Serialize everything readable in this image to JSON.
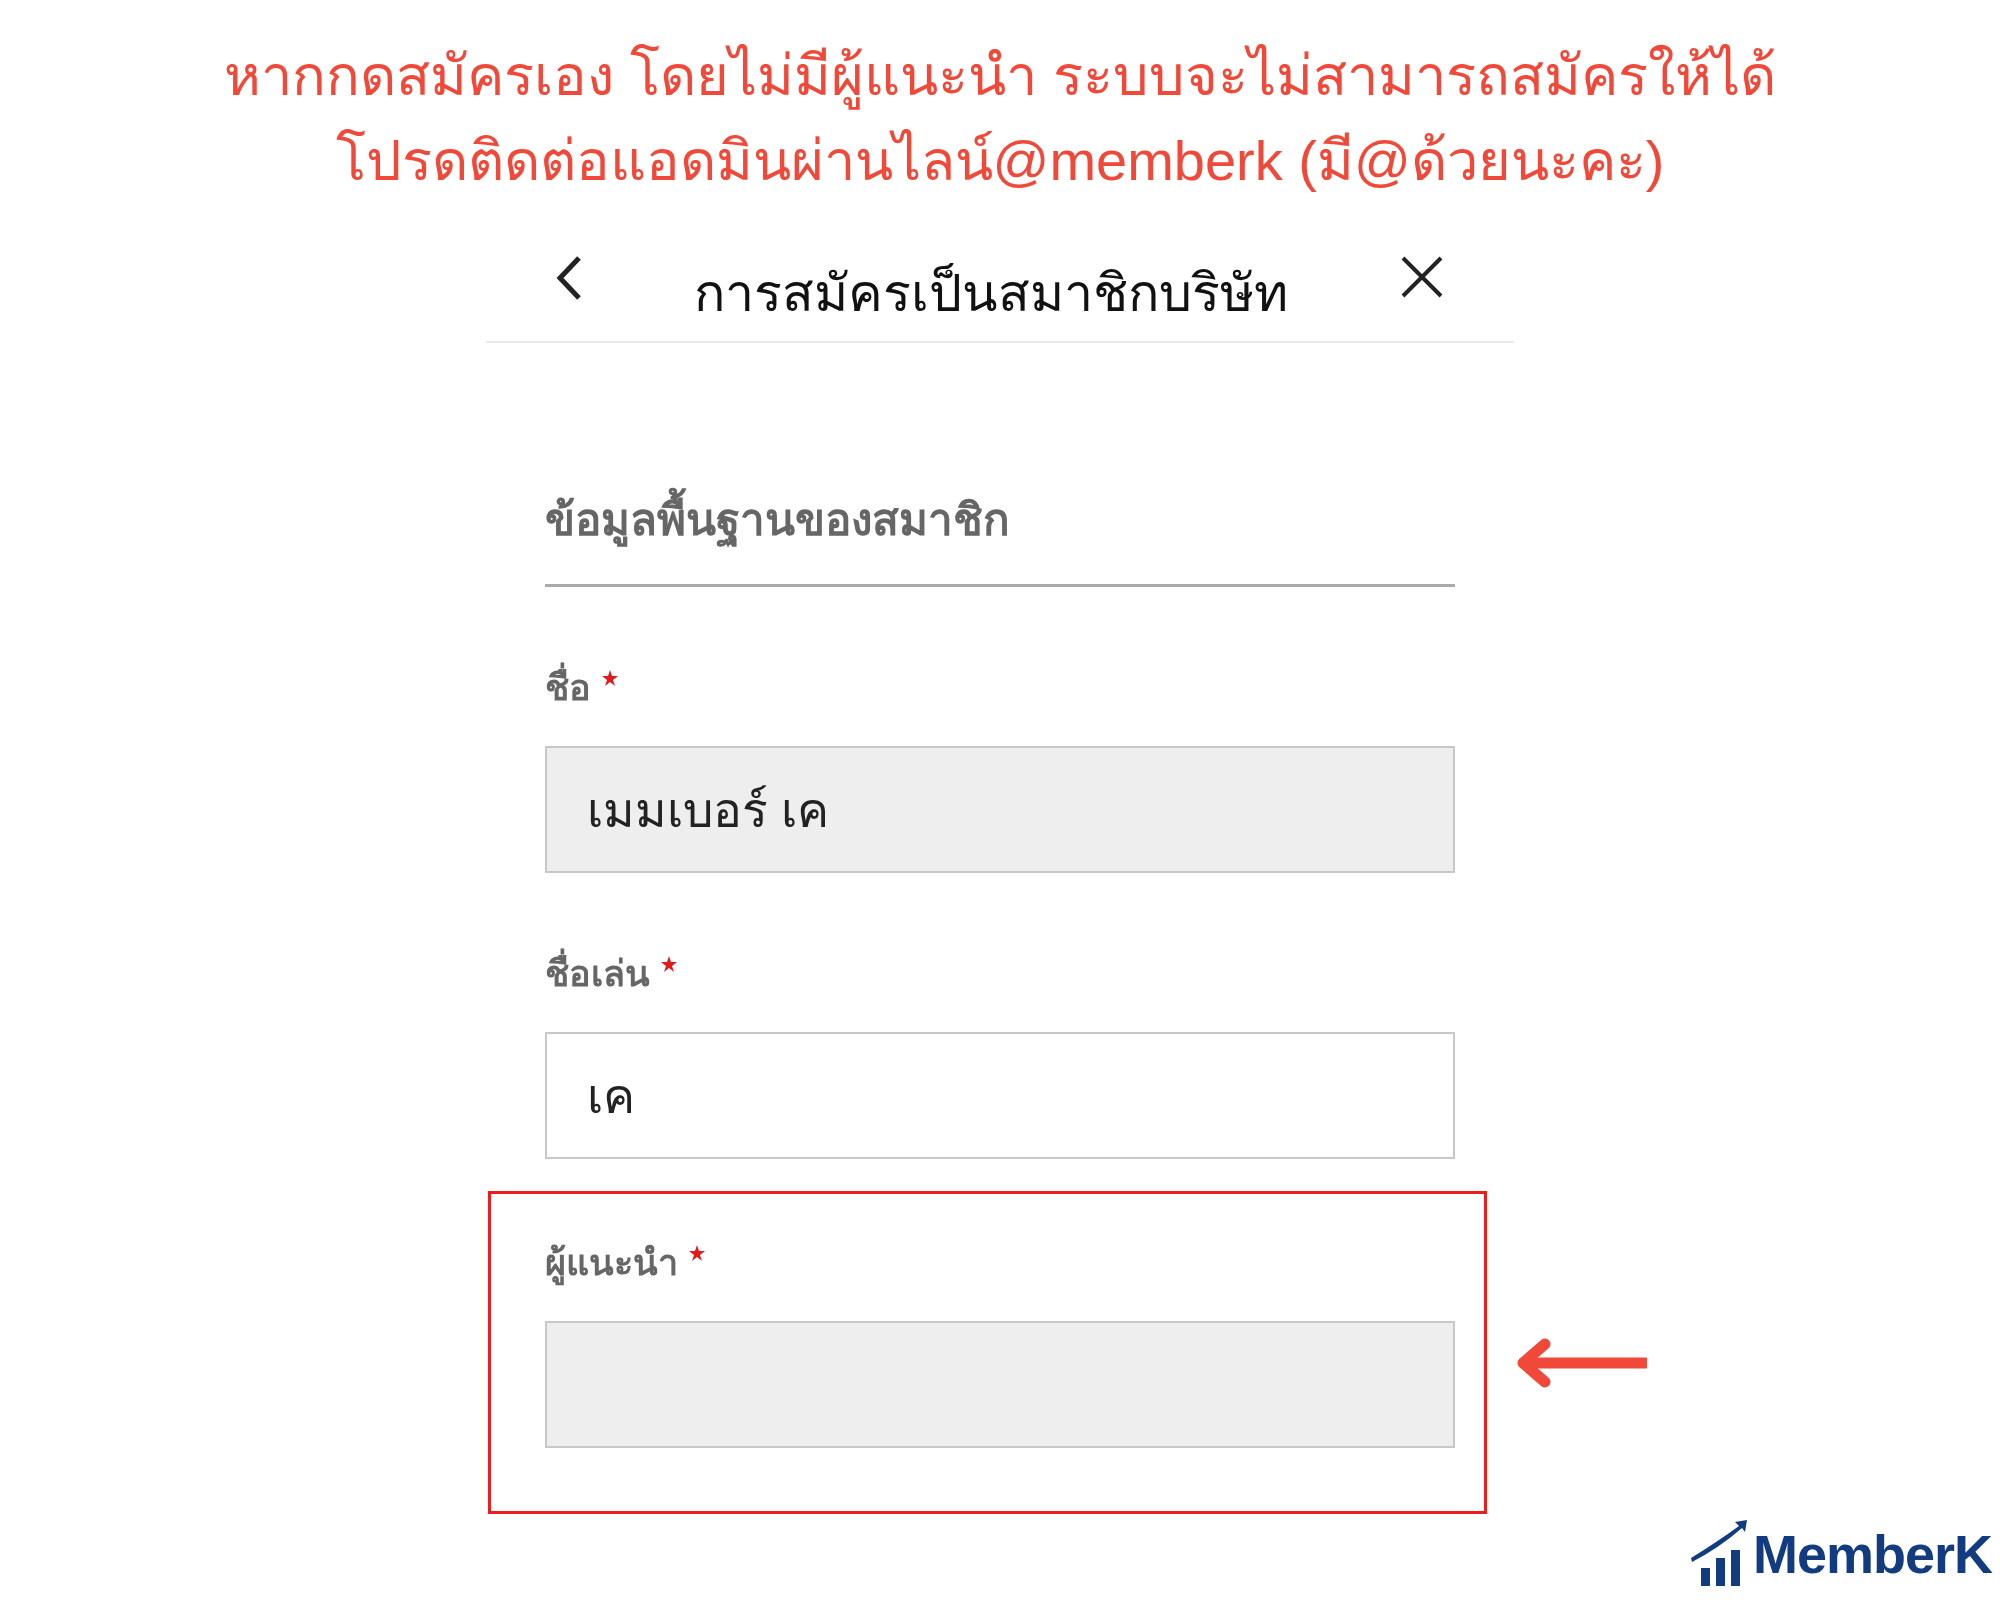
{
  "notice": [
    "หากกดสมัครเอง โดยไม่มีผู้แนะนำ ระบบจะไม่สามารถสมัครให้ได้",
    "โปรดติดต่อแอดมินผ่านไลน์@memberk (มี@ด้วยนะคะ)"
  ],
  "header": {
    "title": "การสมัครเป็นสมาชิกบริษัท"
  },
  "section": {
    "title": "ข้อมูลพื้นฐานของสมาชิก"
  },
  "fields": [
    {
      "label": "ชื่อ",
      "required": true,
      "value": "เมมเบอร์ เค",
      "disabled": true,
      "highlighted": false
    },
    {
      "label": "ชื่อเล่น",
      "required": true,
      "value": "เค",
      "disabled": false,
      "highlighted": false
    },
    {
      "label": "ผู้แนะนำ",
      "required": true,
      "disabled": true,
      "highlighted": true
    }
  ],
  "logo": {
    "text": "MemberK"
  }
}
